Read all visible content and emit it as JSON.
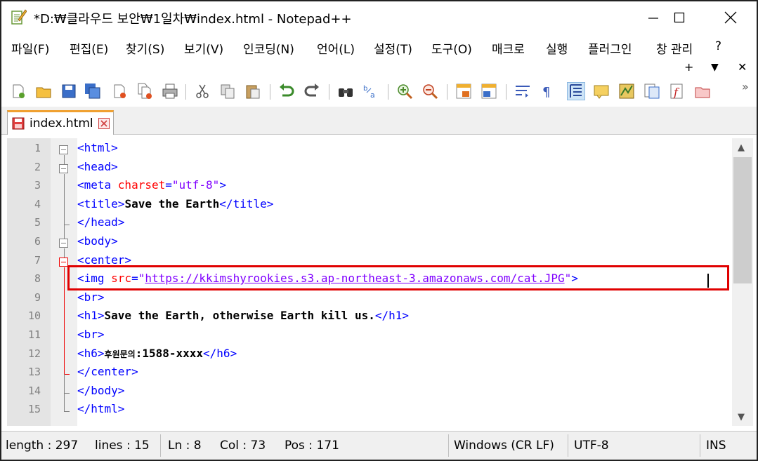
{
  "window": {
    "title": "*D:₩클라우드 보안₩1일차₩index.html - Notepad++",
    "minimize_glyph": "—",
    "maximize_glyph": "☐",
    "close_glyph": "✕"
  },
  "menu": {
    "items": [
      "파일(F)",
      "편집(E)",
      "찾기(S)",
      "보기(V)",
      "인코딩(N)",
      "언어(L)",
      "설정(T)",
      "도구(O)",
      "매크로",
      "실행",
      "플러그인",
      "창 관리",
      "?"
    ],
    "right": {
      "plus": "+",
      "down": "▼",
      "close": "✕"
    }
  },
  "toolbar": {
    "overflow": "»",
    "icons": [
      "new-file-icon",
      "open-file-icon",
      "save-icon",
      "save-all-icon",
      "close-icon",
      "close-all-icon",
      "print-icon",
      "cut-icon",
      "copy-icon",
      "paste-icon",
      "undo-icon",
      "redo-icon",
      "find-icon",
      "replace-icon",
      "zoom-in-icon",
      "zoom-out-icon",
      "sync-v-icon",
      "sync-h-icon",
      "word-wrap-icon",
      "show-all-chars-icon",
      "indent-guide-icon",
      "udl-icon",
      "doc-map-icon",
      "function-list-icon",
      "folder-workspace-icon",
      "monitoring-icon"
    ]
  },
  "tabs": [
    {
      "label": "index.html"
    }
  ],
  "editor": {
    "line_numbers": [
      "1",
      "2",
      "3",
      "4",
      "5",
      "6",
      "7",
      "8",
      "9",
      "10",
      "11",
      "12",
      "13",
      "14",
      "15"
    ],
    "lines": [
      {
        "parts": [
          {
            "c": "tag",
            "t": "<html>"
          }
        ]
      },
      {
        "parts": [
          {
            "c": "tag",
            "t": "<head>"
          }
        ]
      },
      {
        "parts": [
          {
            "c": "tag",
            "t": "<meta "
          },
          {
            "c": "attr",
            "t": "charset"
          },
          {
            "c": "tag",
            "t": "="
          },
          {
            "c": "val",
            "t": "\"utf-8\""
          },
          {
            "c": "tag",
            "t": ">"
          }
        ]
      },
      {
        "parts": [
          {
            "c": "tag",
            "t": "<title>"
          },
          {
            "c": "txt",
            "t": "Save the Earth"
          },
          {
            "c": "tag",
            "t": "</title>"
          }
        ]
      },
      {
        "parts": [
          {
            "c": "tag",
            "t": "</head>"
          }
        ]
      },
      {
        "parts": [
          {
            "c": "tag",
            "t": "<body>"
          }
        ]
      },
      {
        "parts": [
          {
            "c": "tag",
            "t": "<center>"
          }
        ]
      },
      {
        "parts": [
          {
            "c": "tag",
            "t": "<img "
          },
          {
            "c": "attr",
            "t": "src"
          },
          {
            "c": "tag",
            "t": "="
          },
          {
            "c": "val",
            "t": "\""
          },
          {
            "c": "url",
            "t": "https://kkimshyrookies.s3.ap-northeast-3.amazonaws.com/cat.JPG"
          },
          {
            "c": "val",
            "t": "\""
          },
          {
            "c": "tag",
            "t": ">"
          }
        ]
      },
      {
        "parts": [
          {
            "c": "tag",
            "t": "<br>"
          }
        ]
      },
      {
        "parts": [
          {
            "c": "tag",
            "t": "<h1>"
          },
          {
            "c": "txt",
            "t": "Save the Earth, otherwise Earth kill us."
          },
          {
            "c": "tag",
            "t": "</h1>"
          }
        ]
      },
      {
        "parts": [
          {
            "c": "tag",
            "t": "<br>"
          }
        ]
      },
      {
        "parts": [
          {
            "c": "tag",
            "t": "<h6>"
          },
          {
            "c": "hangul",
            "t": "후원문의"
          },
          {
            "c": "txt",
            "t": ":1588-xxxx"
          },
          {
            "c": "tag",
            "t": "</h6>"
          }
        ]
      },
      {
        "parts": [
          {
            "c": "tag",
            "t": "</center>"
          }
        ]
      },
      {
        "parts": [
          {
            "c": "tag",
            "t": "</body>"
          }
        ]
      },
      {
        "parts": [
          {
            "c": "tag",
            "t": "</html>"
          }
        ]
      }
    ],
    "scroll_up": "▲",
    "scroll_down": "▼"
  },
  "status": {
    "length": "length : 297",
    "lines": "lines : 15",
    "ln": "Ln : 8",
    "col": "Col : 73",
    "pos": "Pos : 171",
    "eol": "Windows (CR LF)",
    "encoding": "UTF-8",
    "mode": "INS"
  },
  "colors": {
    "tag": "#0000ff",
    "attribute": "#ff0000",
    "value": "#8000ff",
    "highlight_box": "#e00000"
  }
}
